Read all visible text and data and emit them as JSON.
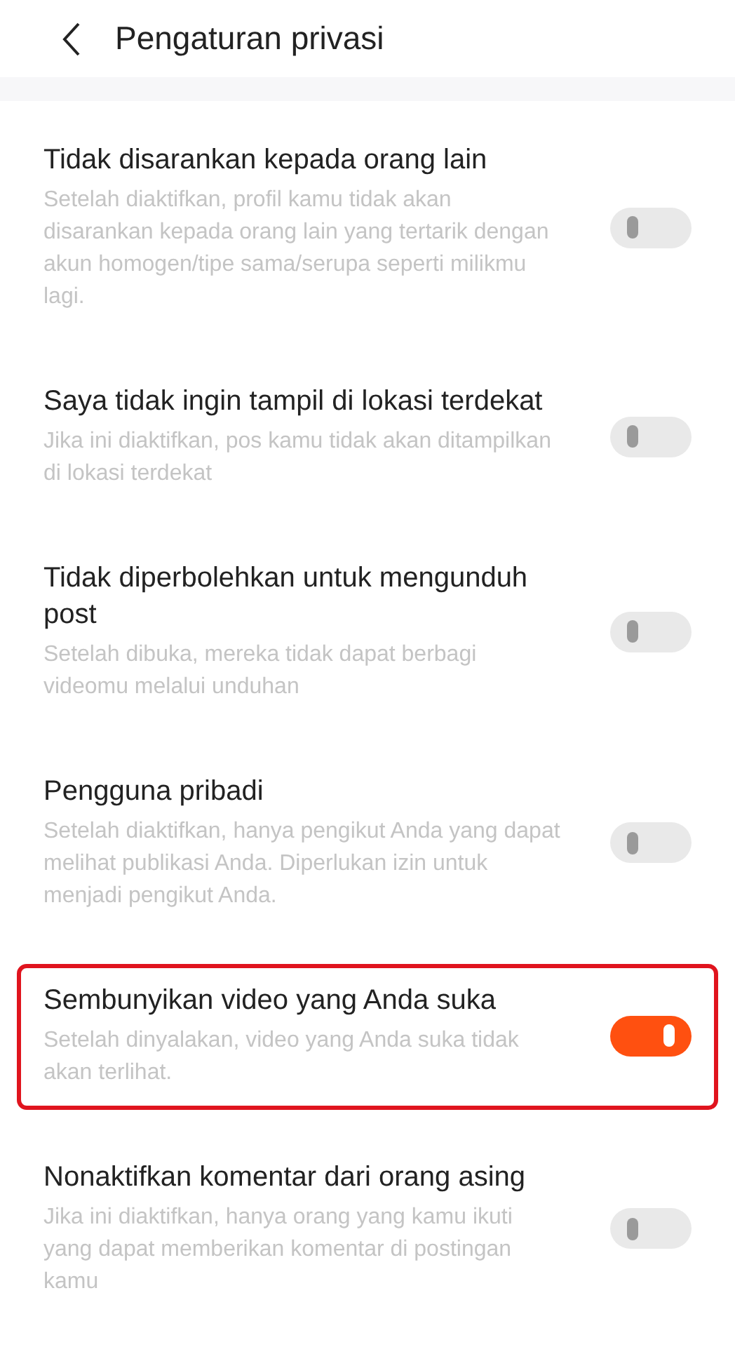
{
  "header": {
    "title": "Pengaturan privasi"
  },
  "settings": [
    {
      "title": "Tidak disarankan kepada orang lain",
      "description": "Setelah diaktifkan, profil kamu tidak akan disarankan kepada orang lain yang tertarik dengan akun homogen/tipe sama/serupa seperti milikmu lagi.",
      "on": false,
      "highlighted": false
    },
    {
      "title": "Saya tidak ingin tampil di lokasi terdekat",
      "description": "Jika ini diaktifkan, pos kamu tidak akan ditampilkan di lokasi terdekat",
      "on": false,
      "highlighted": false
    },
    {
      "title": "Tidak diperbolehkan untuk mengunduh post",
      "description": "Setelah dibuka, mereka tidak dapat berbagi videomu melalui unduhan",
      "on": false,
      "highlighted": false
    },
    {
      "title": "Pengguna pribadi",
      "description": "Setelah diaktifkan, hanya pengikut Anda yang dapat melihat publikasi Anda. Diperlukan izin untuk menjadi pengikut Anda.",
      "on": false,
      "highlighted": false
    },
    {
      "title": "Sembunyikan video yang Anda suka",
      "description": "Setelah dinyalakan, video yang Anda suka tidak akan terlihat.",
      "on": true,
      "highlighted": true
    },
    {
      "title": "Nonaktifkan komentar dari orang asing",
      "description": "Jika ini diaktifkan, hanya orang yang kamu ikuti yang dapat memberikan komentar di postingan kamu",
      "on": false,
      "highlighted": false
    }
  ]
}
